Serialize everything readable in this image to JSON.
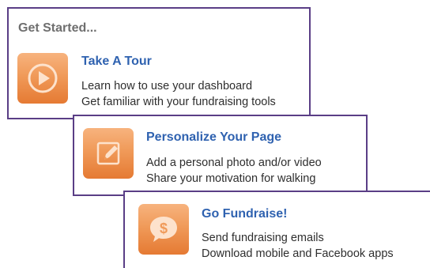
{
  "section_title": "Get Started...",
  "accent_color": "#5a3e86",
  "title_color": "#2f62b0",
  "icon_color": "#f09a59",
  "cards": [
    {
      "icon": "play-icon",
      "title": "Take A Tour",
      "lines": [
        "Learn how to use your dashboard",
        "Get familiar with your fundraising tools"
      ]
    },
    {
      "icon": "pencil-icon",
      "title": "Personalize Your Page",
      "lines": [
        "Add a personal photo and/or video",
        "Share your motivation for walking"
      ]
    },
    {
      "icon": "dollar-speech-bubble-icon",
      "title": "Go Fundraise!",
      "lines": [
        "Send fundraising emails",
        "Download mobile and Facebook apps"
      ]
    }
  ]
}
